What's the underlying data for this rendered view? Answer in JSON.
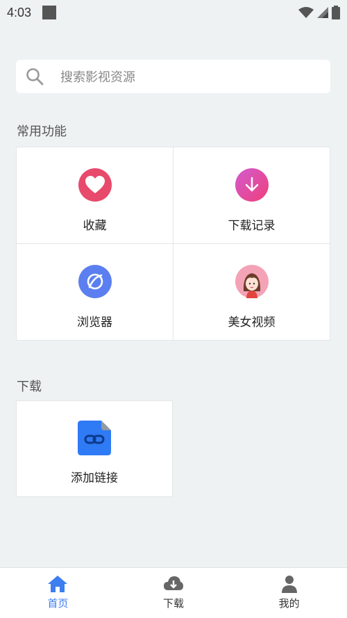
{
  "status_bar": {
    "time": "4:03"
  },
  "search": {
    "placeholder": "搜索影视资源"
  },
  "sections": {
    "common_title": "常用功能",
    "download_title": "下载"
  },
  "features": [
    {
      "label": "收藏",
      "icon": "heart-icon",
      "color": "#e84a6c"
    },
    {
      "label": "下载记录",
      "icon": "download-icon",
      "color": "#e0488e"
    },
    {
      "label": "浏览器",
      "icon": "browser-icon",
      "color": "#5b7ff0"
    },
    {
      "label": "美女视频",
      "icon": "girl-avatar-icon",
      "color": "#f4a3b6"
    }
  ],
  "download_items": [
    {
      "label": "添加链接",
      "icon": "link-file-icon",
      "color": "#2f7af5"
    }
  ],
  "bottom_nav": [
    {
      "label": "首页",
      "icon": "home-icon",
      "active": true
    },
    {
      "label": "下载",
      "icon": "cloud-download-icon",
      "active": false
    },
    {
      "label": "我的",
      "icon": "person-icon",
      "active": false
    }
  ],
  "colors": {
    "accent": "#3d7ef0",
    "background": "#eef2f2"
  }
}
